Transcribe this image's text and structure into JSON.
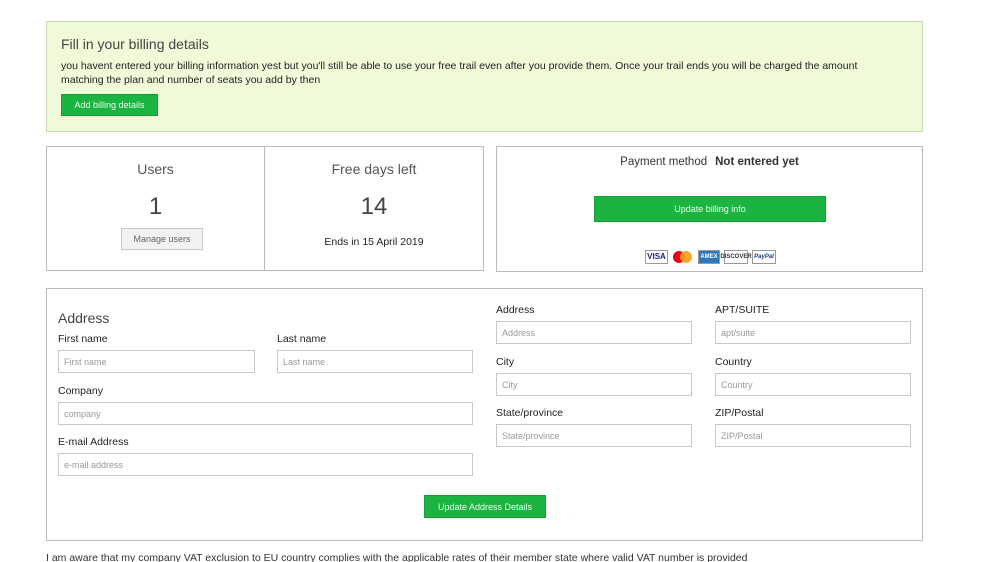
{
  "notice": {
    "title": "Fill in your billing details",
    "text": "you havent entered your billing information yest but you'll still be able to use your free trail even after you provide them. Once your trail ends you will be charged the amount matching the plan and number of seats you add by then",
    "button": "Add billing details"
  },
  "stats": {
    "users_label": "Users",
    "users_value": "1",
    "manage_button": "Manage users",
    "days_label": "Free days left",
    "days_value": "14",
    "ends_text": "Ends in 15 April 2019"
  },
  "payment": {
    "label": "Payment method",
    "status": "Not entered yet",
    "button": "Update billing info",
    "cards": [
      "VISA",
      "",
      "AMEX",
      "DISCOVER",
      "PayPal"
    ]
  },
  "address": {
    "title": "Address",
    "fields": {
      "first_name": {
        "label": "First name",
        "placeholder": "First name"
      },
      "last_name": {
        "label": "Last name",
        "placeholder": "Last name"
      },
      "company": {
        "label": "Company",
        "placeholder": "company"
      },
      "email": {
        "label": "E-mail Address",
        "placeholder": "e-mail address"
      },
      "address": {
        "label": "Address",
        "placeholder": "Address"
      },
      "apt": {
        "label": "APT/SUITE",
        "placeholder": "apt/suite"
      },
      "city": {
        "label": "City",
        "placeholder": "City"
      },
      "country": {
        "label": "Country",
        "placeholder": "Country"
      },
      "state": {
        "label": "State/province",
        "placeholder": "State/province"
      },
      "zip": {
        "label": "ZIP/Postal",
        "placeholder": "ZIP/Postal"
      }
    },
    "button": "Update Address Details"
  },
  "footer": {
    "text": "I am aware that my company VAT exclusion to EU country complies with the applicable rates of their member state where valid VAT number is provided"
  },
  "colors": {
    "accent_green": "#1bb440",
    "notice_background": "#eefad8"
  }
}
